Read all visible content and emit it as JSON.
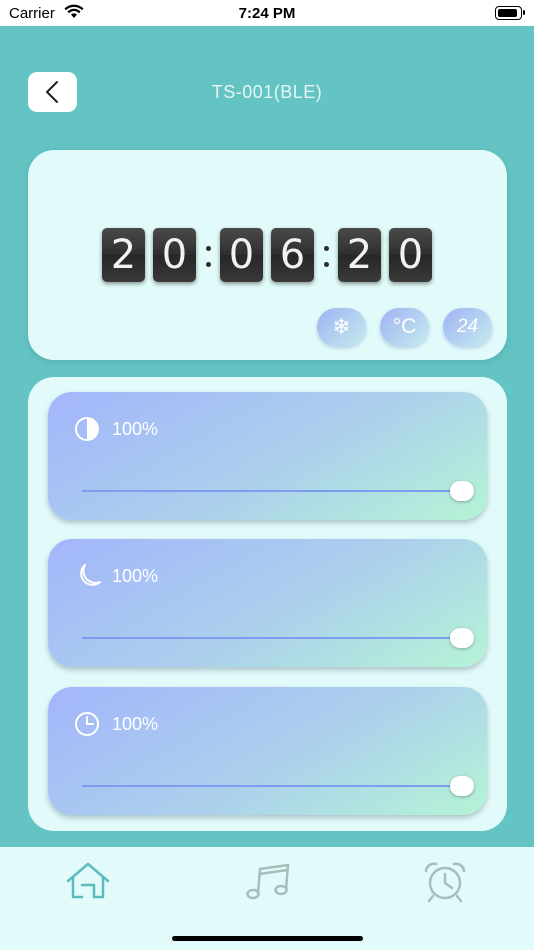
{
  "status_bar": {
    "carrier": "Carrier",
    "time": "7:24 PM"
  },
  "header": {
    "title": "TS-001(BLE)",
    "back_icon": "chevron-left-icon"
  },
  "clock": {
    "hours": [
      "2",
      "0"
    ],
    "minutes": [
      "0",
      "6"
    ],
    "seconds": [
      "2",
      "0"
    ]
  },
  "mode_buttons": [
    {
      "icon": "snowflake-icon",
      "label": "❄"
    },
    {
      "icon": "celsius-icon",
      "label": "°C"
    },
    {
      "icon": "24-hour-icon",
      "label": "24"
    }
  ],
  "sliders": [
    {
      "name": "brightness",
      "icon": "contrast-icon",
      "value_label": "100%",
      "level": 1.0
    },
    {
      "name": "night-light",
      "icon": "moon-icon",
      "value_label": "100%",
      "level": 1.0
    },
    {
      "name": "timer",
      "icon": "clock-icon",
      "value_label": "100%",
      "level": 1.0
    }
  ],
  "tabs": [
    {
      "name": "home",
      "icon": "home-icon",
      "active": true
    },
    {
      "name": "music",
      "icon": "music-note-icon",
      "active": false
    },
    {
      "name": "alarm",
      "icon": "alarm-clock-icon",
      "active": false
    }
  ],
  "colors": {
    "background": "#64c3c3",
    "card": "#e2fbfa",
    "accent_active": "#5cbcbc",
    "accent_inactive": "#a9bcbc",
    "track": "#7f9df0"
  }
}
